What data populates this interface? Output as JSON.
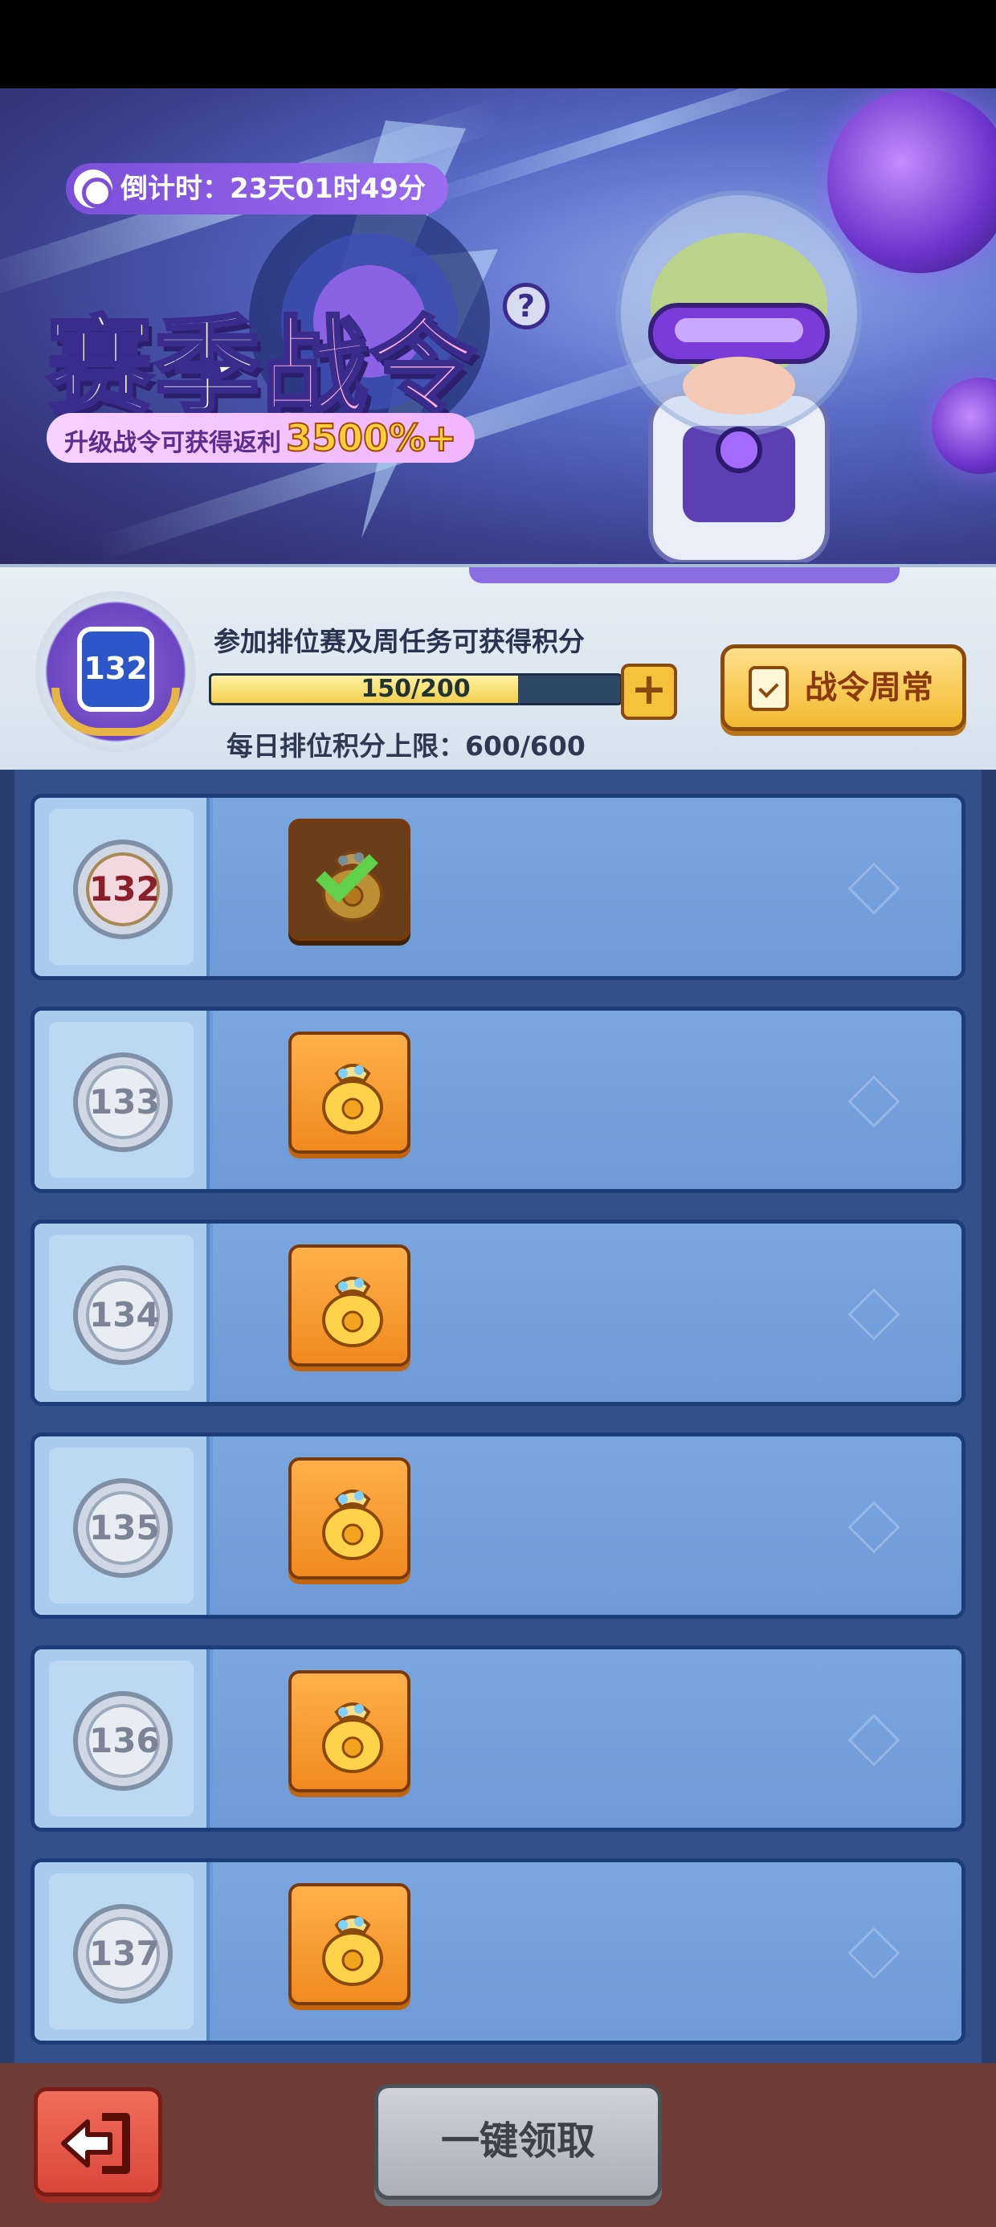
{
  "banner": {
    "countdown": "倒计时：23天01时49分",
    "title_part1": "赛季",
    "title_part2": "战令",
    "help_icon_text": "?",
    "subtitle": "升级战令可获得返利",
    "subtitle_highlight": "3500%+"
  },
  "progress_panel": {
    "level": "132",
    "description": "参加排位赛及周任务可获得积分",
    "progress_text": "150/200",
    "progress_fraction": 0.75,
    "plus_label": "+",
    "daily_limit": "每日排位积分上限：600/600",
    "weekly_button_label": "战令周常"
  },
  "rows": [
    {
      "level": "132",
      "claimed": true,
      "current": true
    },
    {
      "level": "133",
      "claimed": false,
      "current": false
    },
    {
      "level": "134",
      "claimed": false,
      "current": false
    },
    {
      "level": "135",
      "claimed": false,
      "current": false
    },
    {
      "level": "136",
      "claimed": false,
      "current": false
    },
    {
      "level": "137",
      "claimed": false,
      "current": false
    }
  ],
  "bottom": {
    "claim_all_label": "一键领取"
  },
  "icons": {
    "countdown": "stopwatch-icon",
    "help": "question-icon",
    "weekly": "clipboard-check-icon",
    "reward": "lucky-bag-icon",
    "claimed": "check-icon",
    "back": "exit-arrow-icon"
  },
  "colors": {
    "accent_purple": "#7b4fd8",
    "reward_orange": "#f08a1f",
    "claimed_brown": "#6b3e1a",
    "check_green": "#5fd14a",
    "row_blue": "#6e9ad8",
    "back_red": "#d9473b"
  }
}
